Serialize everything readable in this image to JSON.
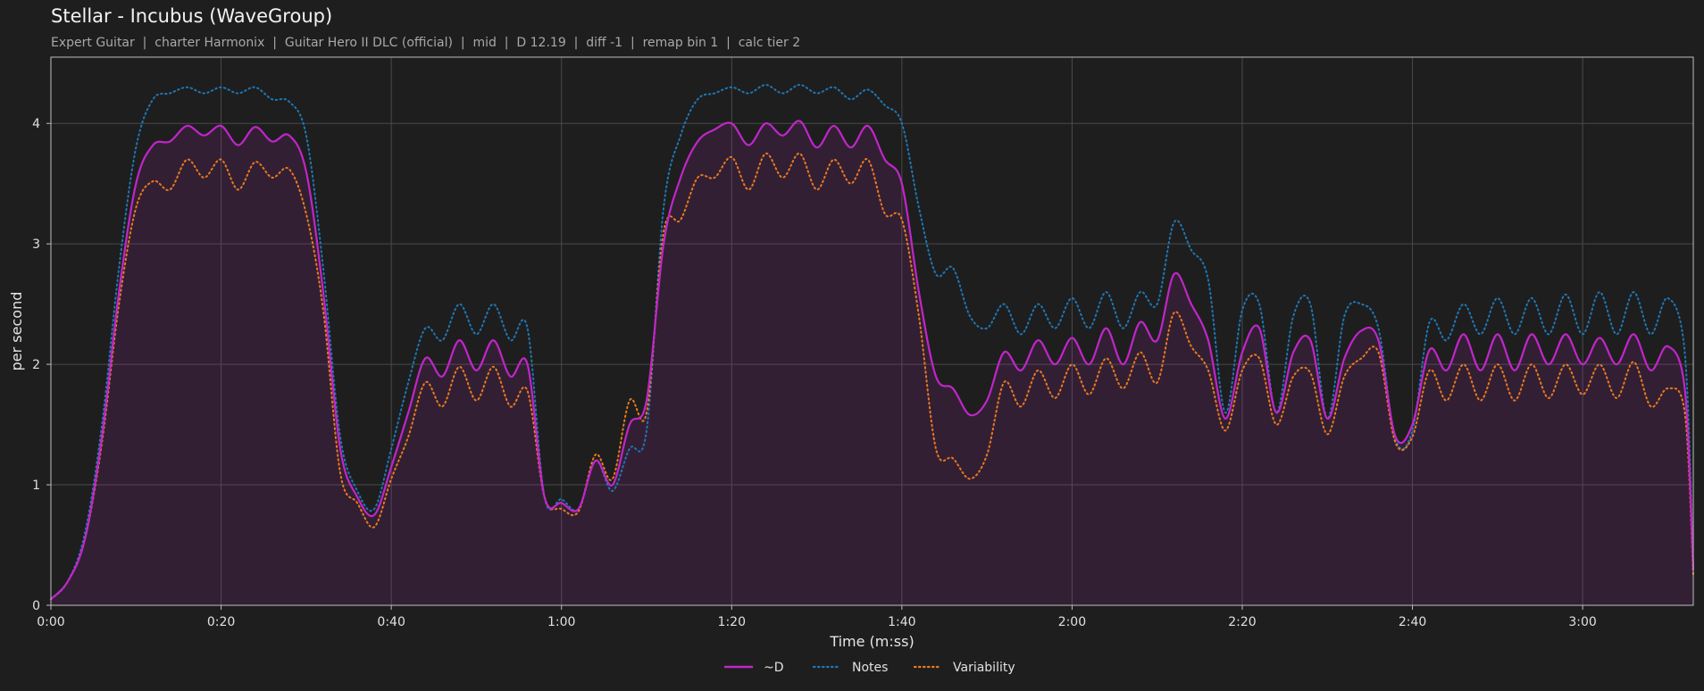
{
  "chart_data": {
    "type": "line",
    "title": "Stellar - Incubus (WaveGroup)",
    "subtitle": "Expert Guitar  |  charter Harmonix  |  Guitar Hero II DLC (official)  |  mid  |  D 12.19  |  diff -1  |  remap bin 1  |  calc tier 2",
    "xlabel": "Time (m:ss)",
    "ylabel": "per second",
    "xlim": [
      0,
      193
    ],
    "ylim": [
      0,
      4.55
    ],
    "x_ticks": [
      0,
      20,
      40,
      60,
      80,
      100,
      120,
      140,
      160,
      180
    ],
    "x_tick_labels": [
      "0:00",
      "0:20",
      "0:40",
      "1:00",
      "1:20",
      "1:40",
      "2:00",
      "2:20",
      "2:40",
      "3:00"
    ],
    "y_ticks": [
      0,
      1,
      2,
      3,
      4
    ],
    "y_tick_labels": [
      "0",
      "1",
      "2",
      "3",
      "4"
    ],
    "grid": true,
    "legend_position": "bottom-center",
    "x": [
      0,
      2,
      4,
      6,
      8,
      10,
      12,
      14,
      16,
      18,
      20,
      22,
      24,
      26,
      28,
      30,
      32,
      34,
      36,
      38,
      40,
      42,
      44,
      46,
      48,
      50,
      52,
      54,
      56,
      58,
      60,
      62,
      64,
      66,
      68,
      70,
      72,
      74,
      76,
      78,
      80,
      82,
      84,
      86,
      88,
      90,
      92,
      94,
      96,
      98,
      100,
      102,
      104,
      106,
      108,
      110,
      112,
      114,
      116,
      118,
      120,
      122,
      124,
      126,
      128,
      130,
      132,
      134,
      136,
      138,
      140,
      142,
      144,
      146,
      148,
      150,
      152,
      154,
      156,
      158,
      160,
      162,
      164,
      166,
      168,
      170,
      172,
      174,
      176,
      178,
      180,
      182,
      184,
      186,
      188,
      190,
      192,
      193
    ],
    "series": [
      {
        "name": "~D",
        "color": "#c026c8",
        "style": "solid",
        "values": [
          0.05,
          0.2,
          0.55,
          1.4,
          2.6,
          3.5,
          3.82,
          3.85,
          3.98,
          3.9,
          3.98,
          3.82,
          3.97,
          3.85,
          3.9,
          3.6,
          2.6,
          1.3,
          0.9,
          0.75,
          1.15,
          1.6,
          2.05,
          1.9,
          2.2,
          1.95,
          2.2,
          1.9,
          2.0,
          0.9,
          0.85,
          0.8,
          1.2,
          1.0,
          1.5,
          1.7,
          3.0,
          3.55,
          3.85,
          3.95,
          4.0,
          3.82,
          4.0,
          3.9,
          4.02,
          3.8,
          3.98,
          3.8,
          3.98,
          3.7,
          3.5,
          2.6,
          1.9,
          1.8,
          1.58,
          1.7,
          2.1,
          1.95,
          2.2,
          2.0,
          2.22,
          2.0,
          2.3,
          2.0,
          2.35,
          2.2,
          2.75,
          2.5,
          2.2,
          1.55,
          2.1,
          2.3,
          1.6,
          2.1,
          2.2,
          1.55,
          2.05,
          2.28,
          2.2,
          1.4,
          1.5,
          2.12,
          1.95,
          2.25,
          1.95,
          2.25,
          1.95,
          2.25,
          2.0,
          2.25,
          2.0,
          2.22,
          2.0,
          2.25,
          1.95,
          2.15,
          1.8,
          0.3
        ]
      },
      {
        "name": "Notes",
        "color": "#1f77b4",
        "style": "dotted",
        "values": [
          0.05,
          0.2,
          0.6,
          1.5,
          2.8,
          3.8,
          4.2,
          4.25,
          4.3,
          4.25,
          4.3,
          4.25,
          4.3,
          4.2,
          4.18,
          3.9,
          2.8,
          1.4,
          0.95,
          0.8,
          1.3,
          1.85,
          2.3,
          2.2,
          2.5,
          2.25,
          2.5,
          2.2,
          2.3,
          0.9,
          0.88,
          0.8,
          1.2,
          0.95,
          1.3,
          1.45,
          3.3,
          3.9,
          4.2,
          4.25,
          4.3,
          4.25,
          4.32,
          4.25,
          4.32,
          4.25,
          4.3,
          4.2,
          4.28,
          4.15,
          4.0,
          3.3,
          2.75,
          2.8,
          2.4,
          2.3,
          2.5,
          2.25,
          2.5,
          2.3,
          2.55,
          2.3,
          2.6,
          2.3,
          2.6,
          2.5,
          3.18,
          2.95,
          2.7,
          1.6,
          2.45,
          2.5,
          1.6,
          2.4,
          2.5,
          1.55,
          2.4,
          2.5,
          2.3,
          1.38,
          1.45,
          2.35,
          2.2,
          2.5,
          2.25,
          2.55,
          2.25,
          2.55,
          2.25,
          2.58,
          2.25,
          2.6,
          2.25,
          2.6,
          2.25,
          2.55,
          2.1,
          0.3
        ]
      },
      {
        "name": "Variability",
        "color": "#e87a1e",
        "style": "dotted",
        "values": [
          0.05,
          0.2,
          0.55,
          1.35,
          2.5,
          3.3,
          3.52,
          3.45,
          3.7,
          3.55,
          3.7,
          3.45,
          3.68,
          3.55,
          3.62,
          3.25,
          2.45,
          1.1,
          0.85,
          0.65,
          1.05,
          1.4,
          1.85,
          1.65,
          1.98,
          1.7,
          1.98,
          1.65,
          1.78,
          0.9,
          0.8,
          0.78,
          1.25,
          1.05,
          1.7,
          1.6,
          3.1,
          3.2,
          3.55,
          3.55,
          3.72,
          3.45,
          3.75,
          3.55,
          3.75,
          3.45,
          3.7,
          3.5,
          3.7,
          3.25,
          3.2,
          2.4,
          1.3,
          1.22,
          1.05,
          1.25,
          1.85,
          1.65,
          1.95,
          1.72,
          2.0,
          1.75,
          2.05,
          1.8,
          2.1,
          1.85,
          2.43,
          2.15,
          1.95,
          1.45,
          1.95,
          2.05,
          1.5,
          1.9,
          1.93,
          1.42,
          1.9,
          2.05,
          2.1,
          1.35,
          1.4,
          1.95,
          1.7,
          2.0,
          1.7,
          2.0,
          1.7,
          2.0,
          1.72,
          2.0,
          1.75,
          2.0,
          1.72,
          2.02,
          1.65,
          1.8,
          1.6,
          0.25
        ]
      }
    ]
  }
}
